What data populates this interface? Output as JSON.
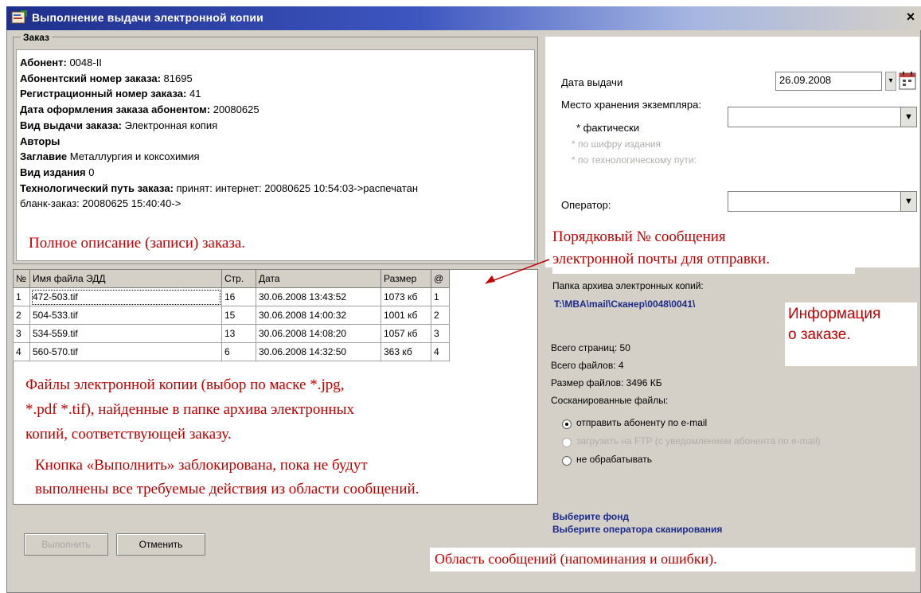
{
  "window": {
    "title": "Выполнение выдачи электронной копии",
    "close_label": "×"
  },
  "order": {
    "legend": "Заказ",
    "fields": [
      {
        "label": "Абонент:",
        "value": " 0048-II"
      },
      {
        "label": "Абонентский номер заказа:",
        "value": " 81695"
      },
      {
        "label": "Регистрационный номер заказа:",
        "value": " 41"
      },
      {
        "label": "Дата оформления заказа абонентом:",
        "value": " 20080625"
      },
      {
        "label": "Вид выдачи заказа:",
        "value": " Электронная копия"
      },
      {
        "label": "Авторы",
        "value": ""
      },
      {
        "label": "Заглавие",
        "value": " Металлургия и коксохимия"
      },
      {
        "label": "Вид издания",
        "value": " 0"
      },
      {
        "label": "Технологический путь заказа:",
        "value": " принят: интернет: 20080625 10:54:03->распечатан"
      }
    ],
    "continuation": "бланк-заказ: 20080625 15:40:40->"
  },
  "callouts": {
    "full_description": "Полное описание (записи) заказа.",
    "email_number_1": "Порядковый № сообщения",
    "email_number_2": "электронной почты для отправки.",
    "order_info_1": "Информация",
    "order_info_2": "о заказе.",
    "files_1": "Файлы электронной копии (выбор по маске *.jpg,",
    "files_2": "*.pdf *.tif), найденные в папке архива электронных",
    "files_3": "копий, соответствующей заказу.",
    "button_1": "Кнопка «Выполнить» заблокирована, пока не будут",
    "button_2": "выполнены все требуемые действия из области",
    "button_3": "сообщений.",
    "messages": "Область сообщений (напоминания и ошибки)."
  },
  "files_table": {
    "headers": [
      "№",
      "Имя файла ЭДД",
      "Стр.",
      "Дата",
      "Размер",
      "@"
    ],
    "rows": [
      [
        "1",
        "472-503.tif",
        "16",
        "30.06.2008 13:43:52",
        "1073 кб",
        "1"
      ],
      [
        "2",
        "504-533.tif",
        "15",
        "30.06.2008 14:00:32",
        "1001 кб",
        "2"
      ],
      [
        "3",
        "534-559.tif",
        "13",
        "30.06.2008 14:08:20",
        "1057 кб",
        "3"
      ],
      [
        "4",
        "560-570.tif",
        "6",
        "30.06.2008 14:32:50",
        "363 кб",
        "4"
      ]
    ]
  },
  "issue": {
    "date_label": "Дата выдачи",
    "date_value": "26.09.2008",
    "storage_label": "Место хранения экземпляра:",
    "actual_label": "* фактически",
    "by_code_label": "* по шифру издания",
    "by_path_label": "* по технологическому пути:",
    "operator_label": "Оператор:"
  },
  "archive": {
    "folder_label": "Папка архива электронных копий:",
    "folder_path": "T:\\MBA\\mail\\Сканер\\0048\\0041\\",
    "total_pages": "Всего страниц: 50",
    "total_files": "Всего файлов: 4",
    "files_size": "Размер файлов: 3496 КБ",
    "scanned_label": "Сосканированные файлы:",
    "options": [
      {
        "label": "отправить абоненту по e-mail",
        "selected": true,
        "enabled": true
      },
      {
        "label": "загрузить на FTP (с уведомлением абонента по e-mail)",
        "selected": false,
        "enabled": false
      },
      {
        "label": "не обрабатывать",
        "selected": false,
        "enabled": true
      }
    ]
  },
  "messages": {
    "line_1": "Выберите фонд",
    "line_2": "Выберите оператора сканирования"
  },
  "buttons": {
    "execute": "Выполнить",
    "cancel": "Отменить"
  }
}
